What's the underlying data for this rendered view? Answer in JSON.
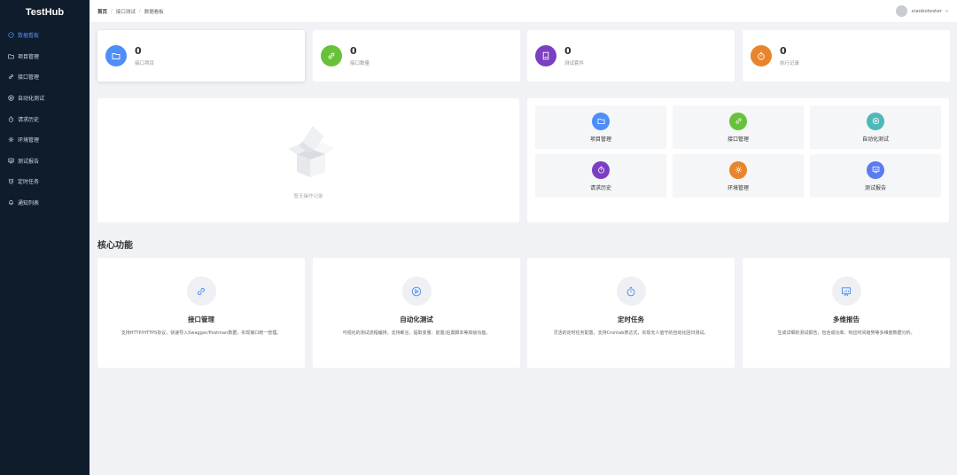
{
  "app": {
    "title": "TestHub"
  },
  "sidebar": {
    "items": [
      {
        "label": "数据看板",
        "icon": "dashboard-icon",
        "active": true
      },
      {
        "label": "项目管理",
        "icon": "folder-icon"
      },
      {
        "label": "接口管理",
        "icon": "link-icon"
      },
      {
        "label": "自动化测试",
        "icon": "play-circle-icon"
      },
      {
        "label": "请求历史",
        "icon": "stopwatch-icon"
      },
      {
        "label": "环境管理",
        "icon": "gear-icon"
      },
      {
        "label": "测试报告",
        "icon": "report-icon"
      },
      {
        "label": "定时任务",
        "icon": "alarm-icon"
      },
      {
        "label": "通知列表",
        "icon": "bell-icon"
      }
    ]
  },
  "header": {
    "breadcrumb": [
      "首页",
      "接口测试",
      "数据看板"
    ],
    "username": "xiaobotester"
  },
  "stats": [
    {
      "value": "0",
      "label": "接口项目",
      "color": "#4e8ef7",
      "icon": "folder-icon"
    },
    {
      "value": "0",
      "label": "接口数量",
      "color": "#67c23a",
      "icon": "link-icon"
    },
    {
      "value": "0",
      "label": "测试套件",
      "color": "#7b3fc4",
      "icon": "document-icon"
    },
    {
      "value": "0",
      "label": "执行记录",
      "color": "#e8852c",
      "icon": "stopwatch-icon"
    }
  ],
  "empty": {
    "text": "暂无操作记录"
  },
  "quick": [
    {
      "label": "项目管理",
      "color": "#4e8ef7",
      "icon": "folder-icon"
    },
    {
      "label": "接口管理",
      "color": "#67c23a",
      "icon": "link-icon"
    },
    {
      "label": "自动化测试",
      "color": "#4fb8b8",
      "icon": "play-circle-icon"
    },
    {
      "label": "请求历史",
      "color": "#7b3fc4",
      "icon": "stopwatch-icon"
    },
    {
      "label": "环境管理",
      "color": "#e8852c",
      "icon": "gear-icon"
    },
    {
      "label": "测试报告",
      "color": "#5b7cf0",
      "icon": "report-icon"
    }
  ],
  "section": {
    "title": "核心功能"
  },
  "features": [
    {
      "title": "接口管理",
      "desc": "支持HTTP/HTTPS协议，快速导入Swagger/Postman数据，实现接口统一管理。",
      "icon": "link-icon"
    },
    {
      "title": "自动化测试",
      "desc": "可视化的测试流程编排，支持断言、提取变量、前置/后置脚本等高级功能。",
      "icon": "play-circle-icon"
    },
    {
      "title": "定时任务",
      "desc": "灵活的定时任务配置，支持Crontab表达式，实现无人值守的自动化回归测试。",
      "icon": "stopwatch-icon"
    },
    {
      "title": "多维报告",
      "desc": "生成详细的测试报告，包含成功率、响应时间趋势等多维度数据分析。",
      "icon": "report-icon"
    }
  ]
}
